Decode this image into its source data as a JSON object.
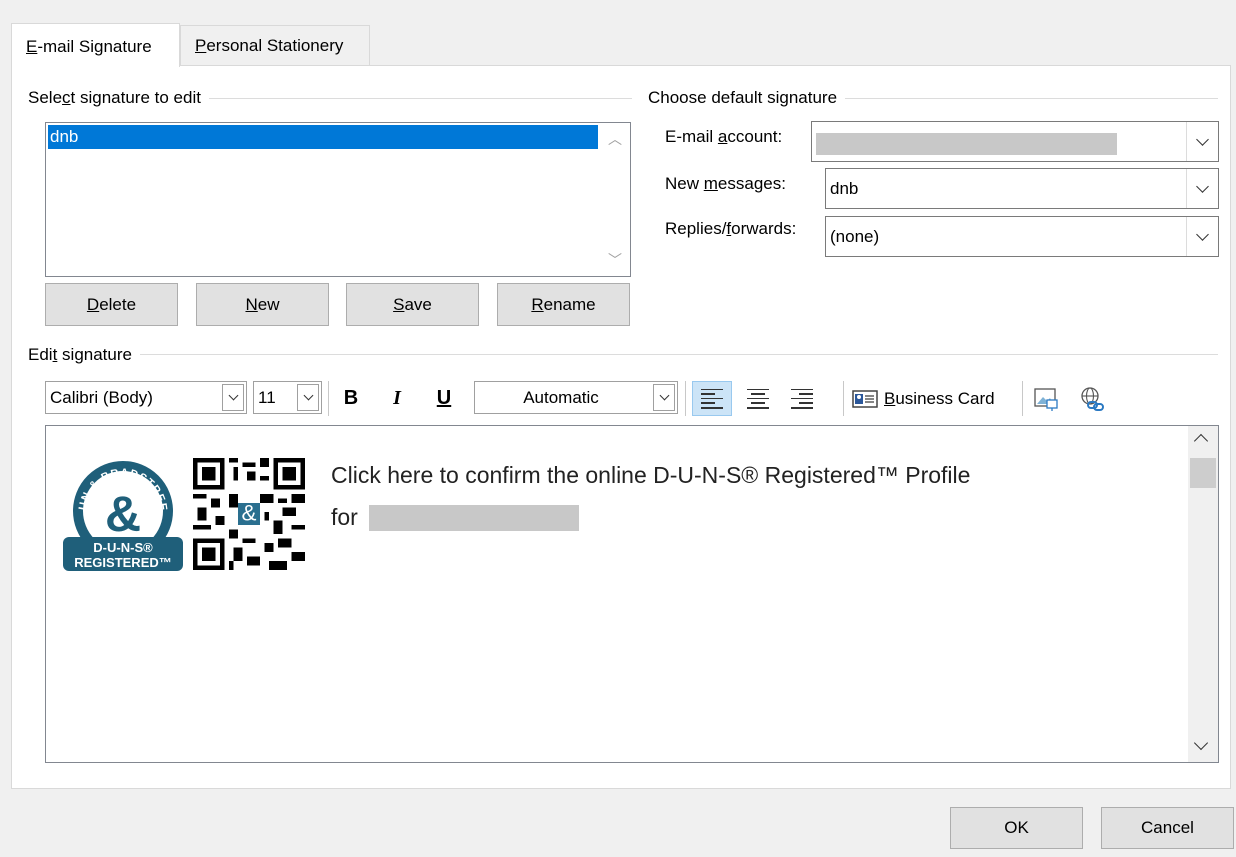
{
  "tabs": [
    {
      "accel": "E",
      "rest": "-mail Signature",
      "active": true
    },
    {
      "accel": "P",
      "rest": "ersonal Stationery",
      "active": false
    }
  ],
  "select_group": {
    "pre": "Sele",
    "accel": "c",
    "post": "t signature to edit"
  },
  "signatures": [
    "dnb"
  ],
  "buttons": [
    {
      "accel": "D",
      "rest": "elete"
    },
    {
      "accel": "N",
      "rest": "ew"
    },
    {
      "accel": "S",
      "rest": "ave"
    },
    {
      "accel": "R",
      "rest": "ename"
    }
  ],
  "default_group": {
    "label": "Choose default signature"
  },
  "email_account": {
    "pre": "E-mail ",
    "accel": "a",
    "post": "ccount:"
  },
  "new_messages": {
    "pre": "New ",
    "accel": "m",
    "post": "essages:",
    "value": "dnb"
  },
  "replies": {
    "pre": "Replies/",
    "accel": "f",
    "post": "orwards:",
    "value": "(none)"
  },
  "edit_group": {
    "pre": "Edi",
    "accel": "t",
    "post": " signature"
  },
  "toolbar": {
    "font": "Calibri (Body)",
    "size": "11",
    "bold": "B",
    "italic": "I",
    "underline": "U",
    "color": "Automatic",
    "business_card": {
      "accel": "B",
      "rest": "usiness Card"
    }
  },
  "signature_body": {
    "line1": "Click here to confirm the online D-U-N-S® Registered™ Profile",
    "line2": "for",
    "badge_top": "DUN & BRADSTREET",
    "badge_mid": "&",
    "badge_l1": "D-U-N-S®",
    "badge_l2": "REGISTERED™"
  },
  "footer": {
    "ok": "OK",
    "cancel": "Cancel"
  },
  "colors": {
    "selection": "#0078d7",
    "button": "#e1e1e1",
    "badge": "#1f5f7a"
  }
}
